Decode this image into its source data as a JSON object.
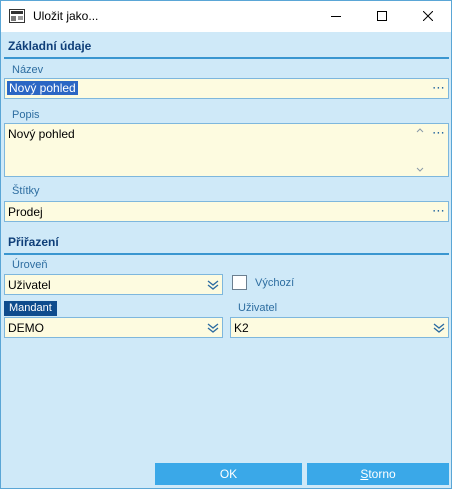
{
  "window": {
    "title": "Uložit jako...",
    "icon": "window-app-icon",
    "controls": {
      "minimize": "minimize-icon",
      "maximize": "maximize-icon",
      "close": "close-icon"
    }
  },
  "sections": {
    "basic": "Základní údaje",
    "assignment": "Přiřazení"
  },
  "fields": {
    "name": {
      "label": "Název",
      "value": "Nový pohled"
    },
    "description": {
      "label": "Popis",
      "value": "Nový pohled"
    },
    "tags": {
      "label": "Štítky",
      "value": "Prodej"
    },
    "level": {
      "label": "Úroveň",
      "value": "Uživatel"
    },
    "default": {
      "label": "Výchozí",
      "checked": false
    },
    "company": {
      "label": "Mandant",
      "value": "DEMO"
    },
    "user": {
      "label": "Uživatel",
      "value": "K2"
    }
  },
  "buttons": {
    "ok": "OK",
    "cancel_first": "S",
    "cancel_rest": "torno"
  },
  "colors": {
    "background": "#cfe9f8",
    "accent": "#3a96d0",
    "button": "#3aa8e8",
    "input_bg": "#fdfbe0",
    "badge": "#0f4c8d"
  }
}
